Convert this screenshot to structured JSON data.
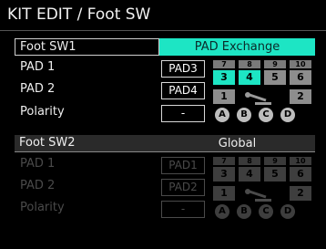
{
  "title": "KIT EDIT / Foot SW",
  "sw1": {
    "header_label": "Foot SW1",
    "header_value": "PAD Exchange",
    "pad1_label": "PAD 1",
    "pad1_value": "PAD3",
    "pad2_label": "PAD 2",
    "pad2_value": "PAD4",
    "polarity_label": "Polarity",
    "polarity_value": "-",
    "grid": {
      "small": [
        "7",
        "8",
        "9",
        "10"
      ],
      "big": [
        "3",
        "4",
        "5",
        "6"
      ],
      "bottom": [
        "1",
        "2"
      ],
      "circles": [
        "A",
        "B",
        "C",
        "D"
      ],
      "active": [
        "3",
        "4"
      ]
    }
  },
  "sw2": {
    "header_label": "Foot SW2",
    "header_value": "Global",
    "pad1_label": "PAD 1",
    "pad1_value": "PAD1",
    "pad2_label": "PAD 2",
    "pad2_value": "PAD2",
    "polarity_label": "Polarity",
    "polarity_value": "-",
    "grid": {
      "small": [
        "7",
        "8",
        "9",
        "10"
      ],
      "big": [
        "3",
        "4",
        "5",
        "6"
      ],
      "bottom": [
        "1",
        "2"
      ],
      "circles": [
        "A",
        "B",
        "C",
        "D"
      ]
    }
  },
  "colors": {
    "accent": "#1de5c4",
    "dim": "#4a4a4a",
    "panel": "#2a2a2a"
  },
  "icons": {
    "pedal": "foot-pedal-icon"
  }
}
